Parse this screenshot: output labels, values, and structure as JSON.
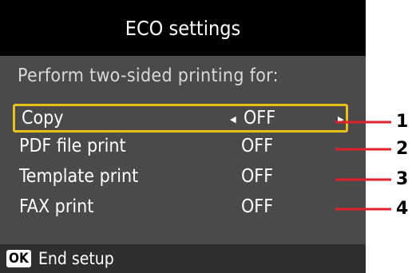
{
  "screen": {
    "title": "ECO settings",
    "prompt": "Perform two-sided printing for:",
    "rows": [
      {
        "label": "Copy",
        "value": "OFF",
        "selected": true
      },
      {
        "label": "PDF file print",
        "value": "OFF",
        "selected": false
      },
      {
        "label": "Template print",
        "value": "OFF",
        "selected": false
      },
      {
        "label": "FAX print",
        "value": "OFF",
        "selected": false
      }
    ],
    "footer": {
      "ok_label": "OK",
      "text": "End setup"
    }
  },
  "callouts": [
    "1",
    "2",
    "3",
    "4"
  ],
  "colors": {
    "title_bg": "#000000",
    "screen_bg": "#4a4a4a",
    "selection_border": "#e8c21a",
    "callout_line": "#e0202a"
  },
  "icons": {
    "left_arrow": "triangle-left-icon",
    "right_arrow": "triangle-right-icon"
  }
}
